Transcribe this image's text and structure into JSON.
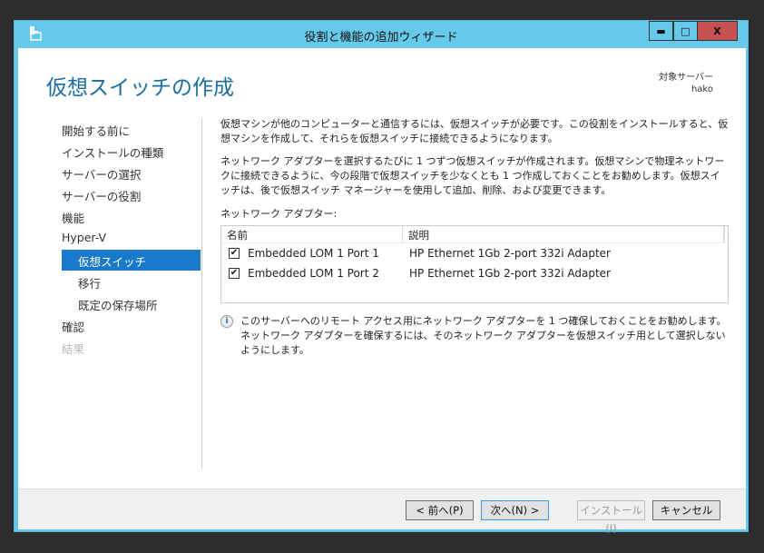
{
  "window": {
    "title": "役割と機能の追加ウィザード",
    "minimize": "▬",
    "maximize": "□",
    "close": "X"
  },
  "header": {
    "page_title": "仮想スイッチの作成",
    "target_label": "対象サーバー",
    "target_server": "hako"
  },
  "nav": {
    "items": [
      {
        "label": "開始する前に",
        "state": "normal"
      },
      {
        "label": "インストールの種類",
        "state": "normal"
      },
      {
        "label": "サーバーの選択",
        "state": "normal"
      },
      {
        "label": "サーバーの役割",
        "state": "normal"
      },
      {
        "label": "機能",
        "state": "normal"
      },
      {
        "label": "Hyper-V",
        "state": "normal"
      },
      {
        "label": "仮想スイッチ",
        "state": "selected"
      },
      {
        "label": "移行",
        "state": "normal"
      },
      {
        "label": "既定の保存場所",
        "state": "normal"
      },
      {
        "label": "確認",
        "state": "normal"
      },
      {
        "label": "結果",
        "state": "disabled"
      }
    ]
  },
  "main": {
    "para1": "仮想マシンが他のコンピューターと通信するには、仮想スイッチが必要です。この役割をインストールすると、仮想マシンを作成して、それらを仮想スイッチに接続できるようになります。",
    "para2": "ネットワーク アダプターを選択するたびに 1 つずつ仮想スイッチが作成されます。仮想マシンで物理ネットワークに接続できるように、今の段階で仮想スイッチを少なくとも 1 つ作成しておくことをお勧めします。仮想スイッチは、後で仮想スイッチ マネージャーを使用して追加、削除、および変更できます。",
    "adapters_label": "ネットワーク アダプター:",
    "columns": [
      "名前",
      "説明"
    ],
    "rows": [
      {
        "checked": true,
        "name": "Embedded LOM 1 Port 1",
        "description": "HP Ethernet 1Gb 2-port 332i Adapter"
      },
      {
        "checked": true,
        "name": "Embedded LOM 1 Port 2",
        "description": "HP Ethernet 1Gb 2-port 332i Adapter"
      }
    ],
    "info": "このサーバーへのリモート アクセス用にネットワーク アダプターを 1 つ確保しておくことをお勧めします。ネットワーク アダプターを確保するには、そのネットワーク アダプターを仮想スイッチ用として選択しないようにします。"
  },
  "footer": {
    "prev": "< 前へ(P)",
    "next": "次へ(N) >",
    "install": "インストール(I)",
    "cancel": "キャンセル"
  },
  "colors": {
    "frame": "#66c9ea",
    "accent": "#1979ca",
    "title": "#1a6fa0",
    "close": "#c75050"
  }
}
